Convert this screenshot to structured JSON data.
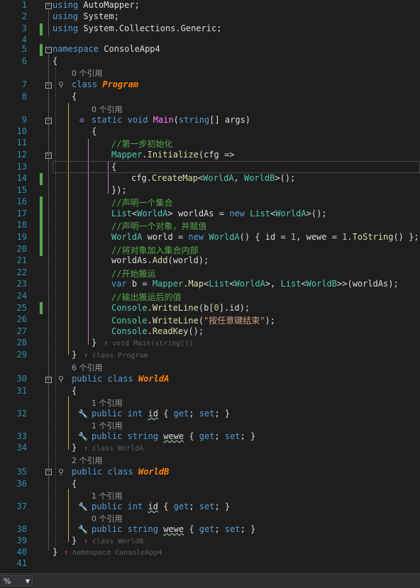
{
  "line_numbers": [
    "1",
    "2",
    "3",
    "4",
    "5",
    "6",
    "7",
    "8",
    "9",
    "10",
    "11",
    "12",
    "13",
    "14",
    "15",
    "16",
    "17",
    "18",
    "19",
    "20",
    "21",
    "22",
    "23",
    "24",
    "25",
    "26",
    "27",
    "28",
    "29",
    "30",
    "31",
    "32",
    "33",
    "34",
    "35",
    "36",
    "37",
    "38",
    "39",
    "40",
    "41"
  ],
  "refs": {
    "program": "0 个引用",
    "main": "0 个引用",
    "worlda": "6 个引用",
    "worlda_id": "1 个引用",
    "worlda_wewe": "1 个引用",
    "worldb": "2 个引用",
    "worldb_id": "1 个引用",
    "worldb_wewe": "0 个引用"
  },
  "code": {
    "l1": "AutoMapper;",
    "l2": "System;",
    "l3": "System.Collections.Generic;",
    "ns": "ConsoleApp4",
    "program": "Program",
    "worlda": "WorldA",
    "worldb": "WorldB",
    "c11": "//第一步初始化",
    "c16": "//声明一个集合",
    "c18": "//声明一个对象，并赋值",
    "c20": "//将对象加入集合内部",
    "c22": "//开始搬运",
    "c24": "//输出搬运后的值",
    "str27": "\"按任意键结束\""
  },
  "end_hints": {
    "main": "void Main(string[])",
    "program": "class Program",
    "worlda": "class WorldA",
    "worldb": "class WorldB",
    "ns": "namespace ConsoleApp4"
  },
  "status": {
    "zoom": "%"
  }
}
